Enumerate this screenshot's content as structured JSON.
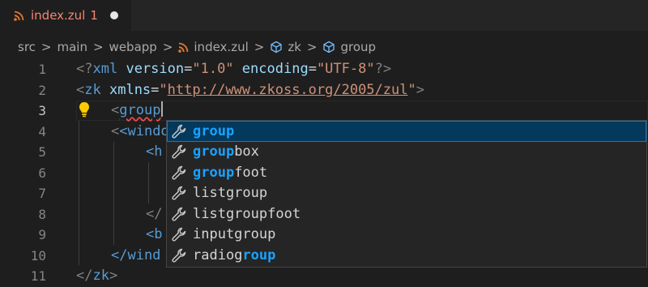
{
  "tab": {
    "filename": "index.zul",
    "problem_count": "1",
    "icon": "rss-icon",
    "dirty": true
  },
  "breadcrumbs": {
    "src": "src",
    "main": "main",
    "webapp": "webapp",
    "file": "index.zul",
    "zk": "zk",
    "group": "group",
    "separator": ">"
  },
  "line_numbers": [
    "1",
    "2",
    "3",
    "4",
    "5",
    "6",
    "7",
    "8",
    "9",
    "10",
    "11"
  ],
  "code": {
    "l1": {
      "open": "<?",
      "tag": "xml",
      "a1": "version",
      "eq1": "=",
      "v1": "\"1.0\"",
      "a2": "encoding",
      "eq2": "=",
      "v2": "\"UTF-8\"",
      "close": "?>"
    },
    "l2": {
      "open": "<",
      "tag": "zk",
      "attr": "xmlns",
      "eq": "=",
      "q1": "\"",
      "url": "http://www.zkoss.org/2005/zul",
      "q2": "\"",
      "close": ">"
    },
    "l3": {
      "open": "<",
      "typed": "group"
    },
    "l4": {
      "text": "<windo",
      "right": "d("
    },
    "l5": {
      "text": "<h"
    },
    "l8": {
      "text": "</"
    },
    "l9": {
      "text": "<b"
    },
    "l10": {
      "text": "</wind"
    },
    "l11": {
      "open": "</",
      "tag": "zk",
      "close": ">"
    }
  },
  "suggestions": [
    {
      "match": "group",
      "rest": "",
      "pre": "",
      "selected": true
    },
    {
      "match": "group",
      "rest": "box",
      "pre": "",
      "selected": false
    },
    {
      "match": "group",
      "rest": "foot",
      "pre": "",
      "selected": false
    },
    {
      "match": "",
      "rest": "listgroup",
      "pre": "",
      "selected": false
    },
    {
      "match": "",
      "rest": "listgroupfoot",
      "pre": "",
      "selected": false
    },
    {
      "match": "",
      "rest": "inputgroup",
      "pre": "",
      "selected": false
    },
    {
      "match": "roup",
      "rest": "",
      "pre": "radiog",
      "selected": false
    }
  ],
  "colors": {
    "editor_bg": "#1e1e1e",
    "error": "#f48771",
    "tag": "#569cd6",
    "attr": "#9cdcfe",
    "string": "#ce9178",
    "match_highlight": "#18a3ff",
    "selection": "#04395e"
  },
  "icons": {
    "lightbulb": "lightbulb-icon",
    "wrench": "wrench-icon",
    "symbol": "symbol-class-icon"
  }
}
